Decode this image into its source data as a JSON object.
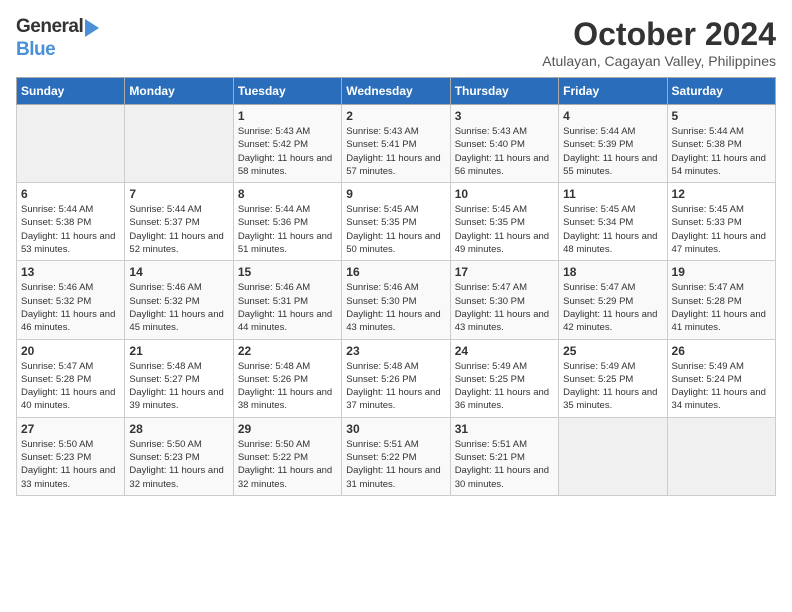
{
  "header": {
    "logo_general": "General",
    "logo_blue": "Blue",
    "month_title": "October 2024",
    "location": "Atulayan, Cagayan Valley, Philippines"
  },
  "weekdays": [
    "Sunday",
    "Monday",
    "Tuesday",
    "Wednesday",
    "Thursday",
    "Friday",
    "Saturday"
  ],
  "weeks": [
    [
      {
        "day": "",
        "sunrise": "",
        "sunset": "",
        "daylight": ""
      },
      {
        "day": "",
        "sunrise": "",
        "sunset": "",
        "daylight": ""
      },
      {
        "day": "1",
        "sunrise": "Sunrise: 5:43 AM",
        "sunset": "Sunset: 5:42 PM",
        "daylight": "Daylight: 11 hours and 58 minutes."
      },
      {
        "day": "2",
        "sunrise": "Sunrise: 5:43 AM",
        "sunset": "Sunset: 5:41 PM",
        "daylight": "Daylight: 11 hours and 57 minutes."
      },
      {
        "day": "3",
        "sunrise": "Sunrise: 5:43 AM",
        "sunset": "Sunset: 5:40 PM",
        "daylight": "Daylight: 11 hours and 56 minutes."
      },
      {
        "day": "4",
        "sunrise": "Sunrise: 5:44 AM",
        "sunset": "Sunset: 5:39 PM",
        "daylight": "Daylight: 11 hours and 55 minutes."
      },
      {
        "day": "5",
        "sunrise": "Sunrise: 5:44 AM",
        "sunset": "Sunset: 5:38 PM",
        "daylight": "Daylight: 11 hours and 54 minutes."
      }
    ],
    [
      {
        "day": "6",
        "sunrise": "Sunrise: 5:44 AM",
        "sunset": "Sunset: 5:38 PM",
        "daylight": "Daylight: 11 hours and 53 minutes."
      },
      {
        "day": "7",
        "sunrise": "Sunrise: 5:44 AM",
        "sunset": "Sunset: 5:37 PM",
        "daylight": "Daylight: 11 hours and 52 minutes."
      },
      {
        "day": "8",
        "sunrise": "Sunrise: 5:44 AM",
        "sunset": "Sunset: 5:36 PM",
        "daylight": "Daylight: 11 hours and 51 minutes."
      },
      {
        "day": "9",
        "sunrise": "Sunrise: 5:45 AM",
        "sunset": "Sunset: 5:35 PM",
        "daylight": "Daylight: 11 hours and 50 minutes."
      },
      {
        "day": "10",
        "sunrise": "Sunrise: 5:45 AM",
        "sunset": "Sunset: 5:35 PM",
        "daylight": "Daylight: 11 hours and 49 minutes."
      },
      {
        "day": "11",
        "sunrise": "Sunrise: 5:45 AM",
        "sunset": "Sunset: 5:34 PM",
        "daylight": "Daylight: 11 hours and 48 minutes."
      },
      {
        "day": "12",
        "sunrise": "Sunrise: 5:45 AM",
        "sunset": "Sunset: 5:33 PM",
        "daylight": "Daylight: 11 hours and 47 minutes."
      }
    ],
    [
      {
        "day": "13",
        "sunrise": "Sunrise: 5:46 AM",
        "sunset": "Sunset: 5:32 PM",
        "daylight": "Daylight: 11 hours and 46 minutes."
      },
      {
        "day": "14",
        "sunrise": "Sunrise: 5:46 AM",
        "sunset": "Sunset: 5:32 PM",
        "daylight": "Daylight: 11 hours and 45 minutes."
      },
      {
        "day": "15",
        "sunrise": "Sunrise: 5:46 AM",
        "sunset": "Sunset: 5:31 PM",
        "daylight": "Daylight: 11 hours and 44 minutes."
      },
      {
        "day": "16",
        "sunrise": "Sunrise: 5:46 AM",
        "sunset": "Sunset: 5:30 PM",
        "daylight": "Daylight: 11 hours and 43 minutes."
      },
      {
        "day": "17",
        "sunrise": "Sunrise: 5:47 AM",
        "sunset": "Sunset: 5:30 PM",
        "daylight": "Daylight: 11 hours and 43 minutes."
      },
      {
        "day": "18",
        "sunrise": "Sunrise: 5:47 AM",
        "sunset": "Sunset: 5:29 PM",
        "daylight": "Daylight: 11 hours and 42 minutes."
      },
      {
        "day": "19",
        "sunrise": "Sunrise: 5:47 AM",
        "sunset": "Sunset: 5:28 PM",
        "daylight": "Daylight: 11 hours and 41 minutes."
      }
    ],
    [
      {
        "day": "20",
        "sunrise": "Sunrise: 5:47 AM",
        "sunset": "Sunset: 5:28 PM",
        "daylight": "Daylight: 11 hours and 40 minutes."
      },
      {
        "day": "21",
        "sunrise": "Sunrise: 5:48 AM",
        "sunset": "Sunset: 5:27 PM",
        "daylight": "Daylight: 11 hours and 39 minutes."
      },
      {
        "day": "22",
        "sunrise": "Sunrise: 5:48 AM",
        "sunset": "Sunset: 5:26 PM",
        "daylight": "Daylight: 11 hours and 38 minutes."
      },
      {
        "day": "23",
        "sunrise": "Sunrise: 5:48 AM",
        "sunset": "Sunset: 5:26 PM",
        "daylight": "Daylight: 11 hours and 37 minutes."
      },
      {
        "day": "24",
        "sunrise": "Sunrise: 5:49 AM",
        "sunset": "Sunset: 5:25 PM",
        "daylight": "Daylight: 11 hours and 36 minutes."
      },
      {
        "day": "25",
        "sunrise": "Sunrise: 5:49 AM",
        "sunset": "Sunset: 5:25 PM",
        "daylight": "Daylight: 11 hours and 35 minutes."
      },
      {
        "day": "26",
        "sunrise": "Sunrise: 5:49 AM",
        "sunset": "Sunset: 5:24 PM",
        "daylight": "Daylight: 11 hours and 34 minutes."
      }
    ],
    [
      {
        "day": "27",
        "sunrise": "Sunrise: 5:50 AM",
        "sunset": "Sunset: 5:23 PM",
        "daylight": "Daylight: 11 hours and 33 minutes."
      },
      {
        "day": "28",
        "sunrise": "Sunrise: 5:50 AM",
        "sunset": "Sunset: 5:23 PM",
        "daylight": "Daylight: 11 hours and 32 minutes."
      },
      {
        "day": "29",
        "sunrise": "Sunrise: 5:50 AM",
        "sunset": "Sunset: 5:22 PM",
        "daylight": "Daylight: 11 hours and 32 minutes."
      },
      {
        "day": "30",
        "sunrise": "Sunrise: 5:51 AM",
        "sunset": "Sunset: 5:22 PM",
        "daylight": "Daylight: 11 hours and 31 minutes."
      },
      {
        "day": "31",
        "sunrise": "Sunrise: 5:51 AM",
        "sunset": "Sunset: 5:21 PM",
        "daylight": "Daylight: 11 hours and 30 minutes."
      },
      {
        "day": "",
        "sunrise": "",
        "sunset": "",
        "daylight": ""
      },
      {
        "day": "",
        "sunrise": "",
        "sunset": "",
        "daylight": ""
      }
    ]
  ]
}
